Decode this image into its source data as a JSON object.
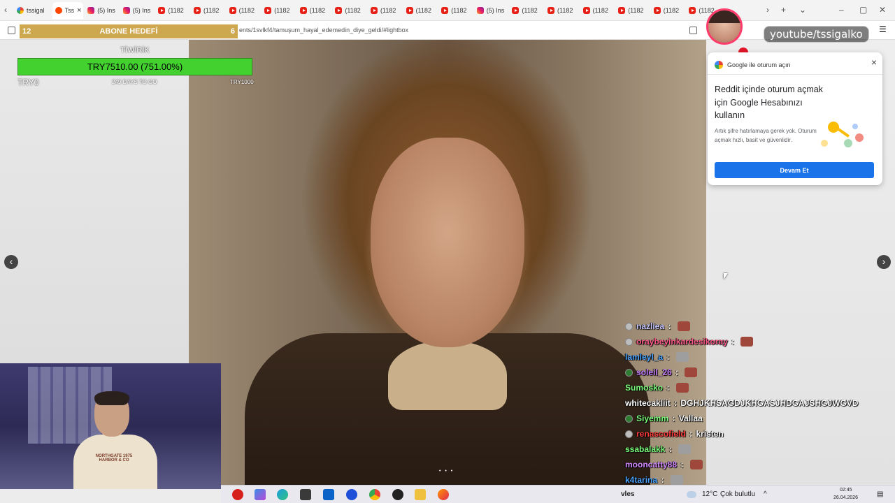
{
  "browser": {
    "tabs": [
      {
        "label": "tssigal",
        "icon": "google",
        "active": false
      },
      {
        "label": "Tss",
        "icon": "reddit",
        "active": true
      },
      {
        "label": "(5) Ins",
        "icon": "instagram",
        "active": false
      },
      {
        "label": "(5) Ins",
        "icon": "instagram",
        "active": false
      },
      {
        "label": "(1182",
        "icon": "youtube",
        "active": false
      },
      {
        "label": "(1182",
        "icon": "youtube",
        "active": false
      },
      {
        "label": "(1182",
        "icon": "youtube",
        "active": false
      },
      {
        "label": "(1182",
        "icon": "youtube",
        "active": false
      },
      {
        "label": "(1182",
        "icon": "youtube",
        "active": false
      },
      {
        "label": "(1182",
        "icon": "youtube",
        "active": false
      },
      {
        "label": "(1182",
        "icon": "youtube",
        "active": false
      },
      {
        "label": "(1182",
        "icon": "youtube",
        "active": false
      },
      {
        "label": "(1182",
        "icon": "youtube",
        "active": false
      },
      {
        "label": "(5) Ins",
        "icon": "instagram",
        "active": false
      },
      {
        "label": "(1182",
        "icon": "youtube",
        "active": false
      },
      {
        "label": "(1182",
        "icon": "youtube",
        "active": false
      },
      {
        "label": "(1182",
        "icon": "youtube",
        "active": false
      },
      {
        "label": "(1182",
        "icon": "youtube",
        "active": false
      },
      {
        "label": "(1182",
        "icon": "youtube",
        "active": false
      },
      {
        "label": "(1182",
        "icon": "youtube",
        "active": false
      }
    ],
    "close_glyph": "×",
    "url": "ents/1svlkf4/tamuşum_hayal_edemedin_diye_geldi/#lightbox"
  },
  "subscriber_goal": {
    "current": "12",
    "title": "ABONE HEDEFİ",
    "target": "6"
  },
  "donation_widget": {
    "title": "TİWİRİK",
    "amount": "TRY7510.00 (751.00%)",
    "min": "TRY0",
    "days": "249 DAYS TO GO",
    "max": "TRY1000"
  },
  "lightbox": {
    "prev_glyph": "‹",
    "next_glyph": "›",
    "dots": "• • •"
  },
  "webcam": {
    "shirt_text": "NORTHGATE 1975 HARBOR & CO"
  },
  "channel": {
    "handle": "youtube/tssigalko"
  },
  "google_popup": {
    "header": "Google ile oturum açın",
    "close_glyph": "×",
    "title": "Reddit içinde oturum açmak için Google Hesabınızı kullanın",
    "description": "Artık şifre hatırlamaya gerek yok. Oturum açmak hızlı, basit ve güvenlidir.",
    "button": "Devam Et"
  },
  "chat": [
    {
      "user": "nazliea",
      "color": "#c8c8ff",
      "badge": "gray",
      "message": "",
      "emote": "red"
    },
    {
      "user": "oraybeyinkardesikoray",
      "color": "#ff5c8a",
      "badge": "gray",
      "message": "",
      "emote": "red"
    },
    {
      "user": "lamleyl_a",
      "color": "#4aa3ff",
      "badge": "",
      "message": "",
      "emote": "cat"
    },
    {
      "user": "soleil_26",
      "color": "#c77dff",
      "badge": "green",
      "message": "",
      "emote": "red"
    },
    {
      "user": "Sumosko",
      "color": "#7dff7d",
      "badge": "",
      "message": "",
      "emote": "red"
    },
    {
      "user": "whitecakliit",
      "color": "#ffffff",
      "badge": "",
      "message": "DGHJKHSAGDJKHGASJHDGAJSHGJWGVD",
      "emote": ""
    },
    {
      "user": "Siyemm",
      "color": "#7dff7d",
      "badge": "green",
      "message": "Vallaa",
      "emote": ""
    },
    {
      "user": "renascofield",
      "color": "#ff3b3b",
      "badge": "gray",
      "message": "kristen",
      "emote": ""
    },
    {
      "user": "ssabalakk",
      "color": "#7dff7d",
      "badge": "",
      "message": "",
      "emote": "cat"
    },
    {
      "user": "mooncatty88",
      "color": "#d28bff",
      "badge": "",
      "message": "",
      "emote": "red"
    },
    {
      "user": "k4tarina",
      "color": "#4aa3ff",
      "badge": "",
      "message": "",
      "emote": "cat"
    }
  ],
  "chat_partial": "vles",
  "taskbar": {
    "temperature": "12°C",
    "weather": "Çok bulutlu",
    "time": "02:45",
    "date": "26.04.2026"
  }
}
